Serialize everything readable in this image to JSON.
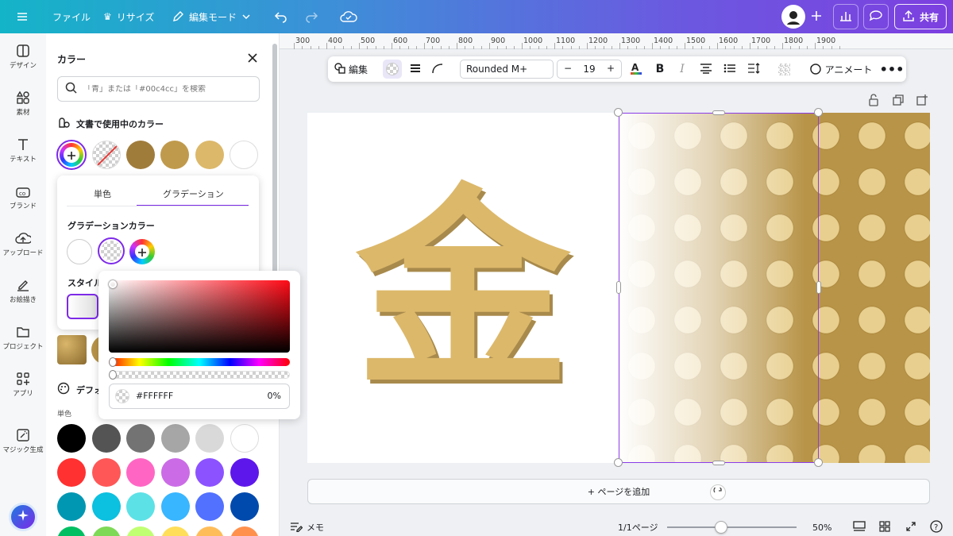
{
  "topbar": {
    "file_label": "ファイル",
    "resize_label": "リサイズ",
    "edit_mode_label": "編集モード",
    "share_label": "共有"
  },
  "siderail": {
    "items": [
      {
        "label": "デザイン",
        "icon": "design-icon"
      },
      {
        "label": "素材",
        "icon": "elements-icon"
      },
      {
        "label": "テキスト",
        "icon": "text-icon"
      },
      {
        "label": "ブランド",
        "icon": "brand-icon"
      },
      {
        "label": "アップロード",
        "icon": "upload-icon"
      },
      {
        "label": "お絵描き",
        "icon": "draw-icon"
      },
      {
        "label": "プロジェクト",
        "icon": "folder-icon"
      },
      {
        "label": "アプリ",
        "icon": "apps-icon"
      },
      {
        "label": "マジック生成",
        "icon": "magic-icon"
      }
    ]
  },
  "panel": {
    "title": "カラー",
    "search_placeholder": "「青」または「#00c4cc」を検索",
    "doc_colors_title": "文書で使用中のカラー",
    "doc_colors": [
      "#a07c3b",
      "#c09a4c",
      "#dcb86a",
      "#ffffff"
    ],
    "tabs": [
      "単色",
      "グラデーション"
    ],
    "gradient_colors_title": "グラデーションカラー",
    "style_title": "スタイル",
    "default_title": "デフォ",
    "solid_label": "単色",
    "palette": [
      [
        "#000000",
        "#545454",
        "#737373",
        "#a6a6a6",
        "#d9d9d9",
        "#ffffff"
      ],
      [
        "#ff3131",
        "#ff5757",
        "#ff66c4",
        "#cb6ce6",
        "#8c52ff",
        "#5e17eb"
      ],
      [
        "#0097b2",
        "#0cc0df",
        "#5ce1e6",
        "#38b6ff",
        "#5271ff",
        "#004aad"
      ],
      [
        "#00bf63",
        "#7ed957",
        "#c1ff72",
        "#ffde59",
        "#ffbd59",
        "#ff914d"
      ]
    ]
  },
  "picker": {
    "hex_value": "#FFFFFF",
    "opacity": "0%"
  },
  "ruler": {
    "labels": [
      "300",
      "400",
      "500",
      "600",
      "700",
      "800",
      "900",
      "1000",
      "1100",
      "1200",
      "1300",
      "1400",
      "1500",
      "1600",
      "1700",
      "1800",
      "1900"
    ]
  },
  "text_toolbar": {
    "edit_label": "編集",
    "font_name": "Rounded M+",
    "font_size": "19",
    "animate_label": "アニメート"
  },
  "canvas": {
    "title_char": "金",
    "title_color": "#dcb86a",
    "add_page_label": "+ ページを追加"
  },
  "footer": {
    "notes_label": "メモ",
    "page_indicator": "1/1ページ",
    "zoom_percent": "50%",
    "zoom_level": 0.42
  },
  "colors": {
    "accent": "#7d2ae8",
    "gold": "#dcb86a"
  }
}
